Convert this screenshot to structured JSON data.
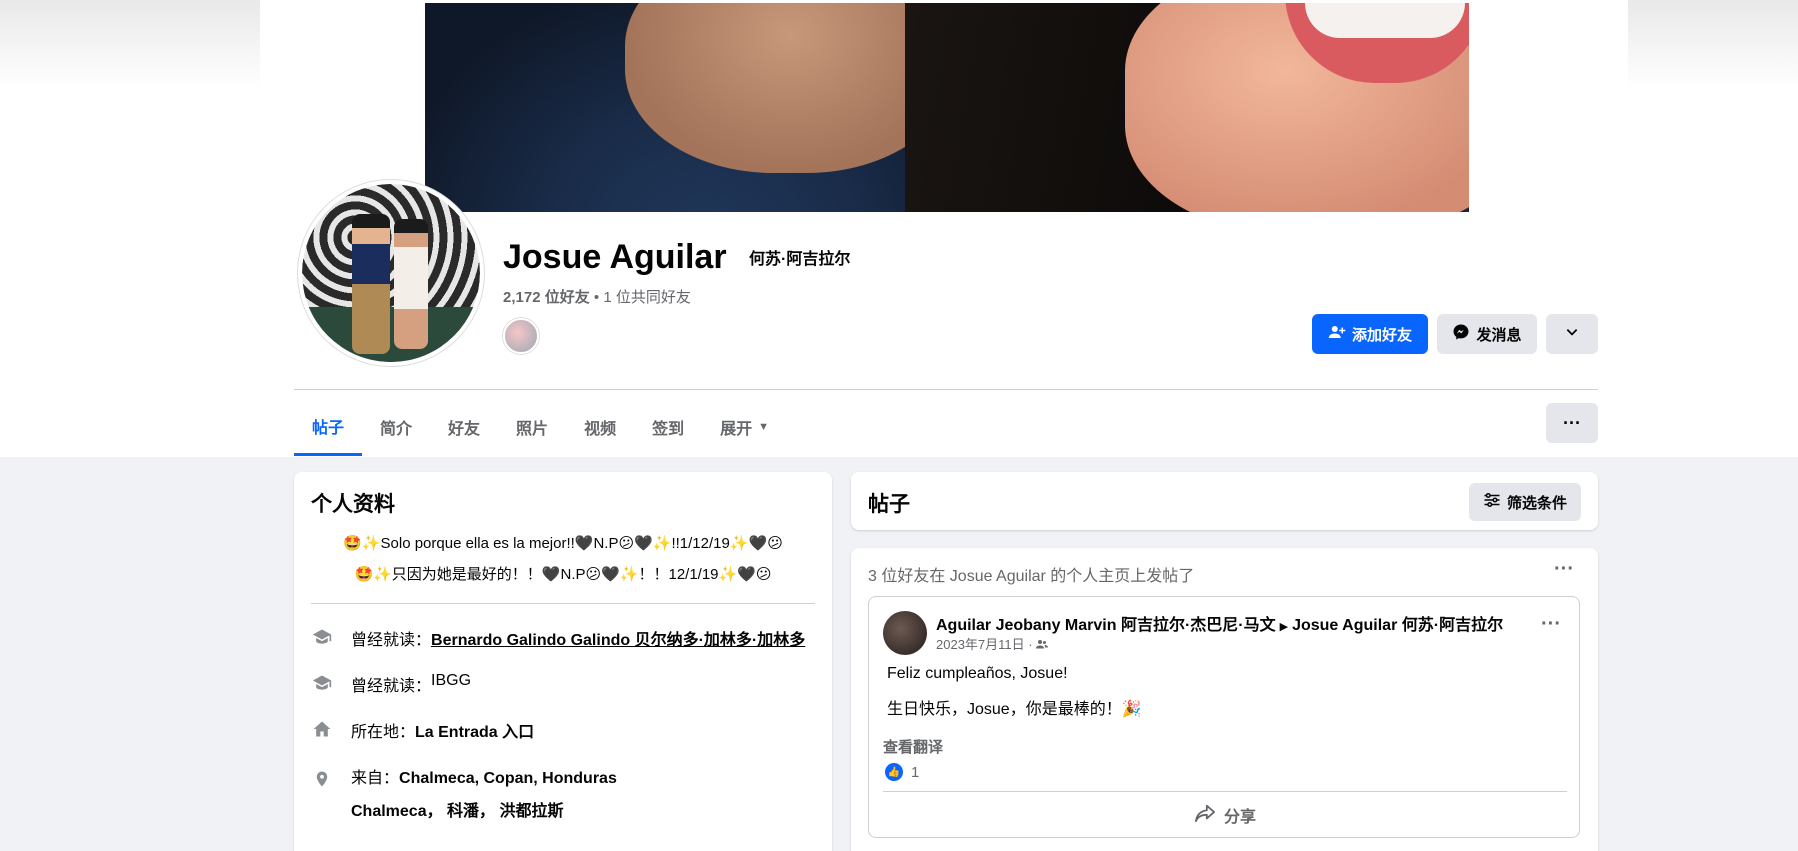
{
  "profile": {
    "name": "Josue Aguilar",
    "alt_name": "何苏·阿吉拉尔",
    "friends_count": "2,172 位好友",
    "friends_sep": " • ",
    "mutual": "1 位共同好友"
  },
  "actions": {
    "add_friend": "添加好友",
    "message": "发消息",
    "more_icon": "chevron-down-icon"
  },
  "tabs": [
    {
      "label": "帖子",
      "active": true
    },
    {
      "label": "简介"
    },
    {
      "label": "好友"
    },
    {
      "label": "照片"
    },
    {
      "label": "视频"
    },
    {
      "label": "签到"
    },
    {
      "label": "展开"
    }
  ],
  "intro": {
    "title": "个人资料",
    "bio_line1": "🤩✨Solo porque ella es la mejor!!🖤N.P😕🖤✨!!1/12/19✨🖤😕",
    "bio_line2": "🤩✨只因为她是最好的！！🖤N.P😕🖤✨！！12/1/19✨🖤😕",
    "rows": [
      {
        "prefix": "曾经就读：",
        "value": "Bernardo Galindo Galindo  贝尔纳多·加林多·加林多"
      },
      {
        "prefix": "曾经就读：",
        "value": "IBGG"
      },
      {
        "prefix": "所在地：",
        "value": "La Entrada  入口"
      },
      {
        "prefix": "来自：",
        "value": "Chalmeca, Copan, Honduras",
        "sub": "Chalmeca， 科潘， 洪都拉斯"
      }
    ]
  },
  "posts_header": {
    "title": "帖子",
    "filter": "筛选条件"
  },
  "feed": {
    "note": "3 位好友在 Josue Aguilar 的个人主页上发帖了",
    "post": {
      "author": "Aguilar Jeobany Marvin  阿吉拉尔·杰巴尼·马文",
      "target": "Josue Aguilar  何苏·阿吉拉尔",
      "date": "2023年7月11日 ·",
      "line1": "Feliz cumpleaños, Josue!",
      "line2": "生日快乐，Josue，你是最棒的！🎉",
      "translate": "查看翻译",
      "likes": "1",
      "share": "分享"
    }
  },
  "colors": {
    "accent": "#0866ff",
    "secondary_text": "#65676b",
    "page_bg": "#f0f2f5"
  }
}
